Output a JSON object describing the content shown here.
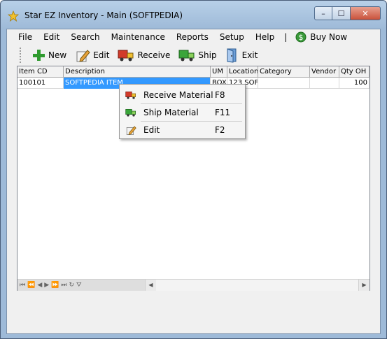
{
  "window": {
    "title": "Star EZ Inventory - Main (SOFTPEDIA)",
    "buttons": {
      "minimize": "–",
      "maximize": "☐",
      "close": "✕"
    }
  },
  "menubar": {
    "items": [
      {
        "label": "File"
      },
      {
        "label": "Edit"
      },
      {
        "label": "Search"
      },
      {
        "label": "Maintenance"
      },
      {
        "label": "Reports"
      },
      {
        "label": "Setup"
      },
      {
        "label": "Help"
      }
    ],
    "separator": "|",
    "buy_now": "Buy Now"
  },
  "toolbar": {
    "new": "New",
    "edit": "Edit",
    "receive": "Receive",
    "ship": "Ship",
    "exit": "Exit"
  },
  "grid": {
    "columns": [
      "Item CD",
      "Description",
      "UM",
      "Location",
      "Category",
      "Vendor (",
      "Qty OH"
    ],
    "rows": [
      {
        "item_cd": "100101",
        "description": "SOFTPEDIA ITEM",
        "um": "BOX",
        "location": "123 SOF",
        "category": "",
        "vendor": "",
        "qty_oh": "100"
      }
    ]
  },
  "context_menu": {
    "items": [
      {
        "label": "Receive Material",
        "shortcut": "F8",
        "icon": "truck-receive-icon"
      },
      {
        "label": "Ship Material",
        "shortcut": "F11",
        "icon": "truck-ship-icon"
      },
      {
        "label": "Edit",
        "shortcut": "F2",
        "icon": "edit-icon"
      }
    ]
  },
  "colors": {
    "selection": "#3399ff",
    "title_bar": "#9ebad8",
    "close_button": "#c9523b"
  }
}
